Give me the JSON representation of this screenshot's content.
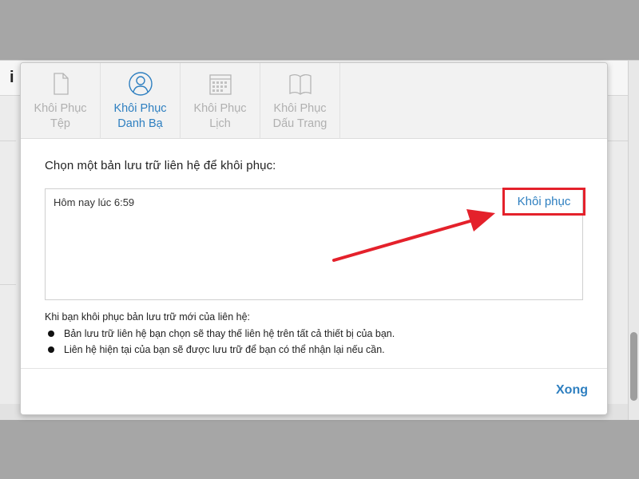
{
  "background": {
    "logo_text": "i"
  },
  "tabs": [
    {
      "line1": "Khôi Phục",
      "line2": "Tệp",
      "icon": "file-icon",
      "active": false
    },
    {
      "line1": "Khôi Phục",
      "line2": "Danh Bạ",
      "icon": "contacts-icon",
      "active": true
    },
    {
      "line1": "Khôi Phục",
      "line2": "Lịch",
      "icon": "calendar-icon",
      "active": false
    },
    {
      "line1": "Khôi Phục",
      "line2": "Dấu Trang",
      "icon": "bookmarks-icon",
      "active": false
    }
  ],
  "content": {
    "prompt": "Chọn một bản lưu trữ liên hệ để khôi phục:",
    "backup": {
      "date": "Hôm nay lúc 6:59",
      "restore_label": "Khôi phục"
    },
    "note": {
      "title": "Khi bạn khôi phục bản lưu trữ mới của liên hệ:",
      "items": [
        "Bản lưu trữ liên hệ bạn chọn sẽ thay thế liên hệ trên tất cả thiết bị của bạn.",
        "Liên hệ hiện tại của bạn sẽ được lưu trữ để bạn có thể nhận lại nếu cần."
      ]
    }
  },
  "footer": {
    "done_label": "Xong"
  },
  "colors": {
    "accent": "#2e7fc0",
    "highlight": "#e4212b",
    "inactive": "#b0b0b0"
  }
}
